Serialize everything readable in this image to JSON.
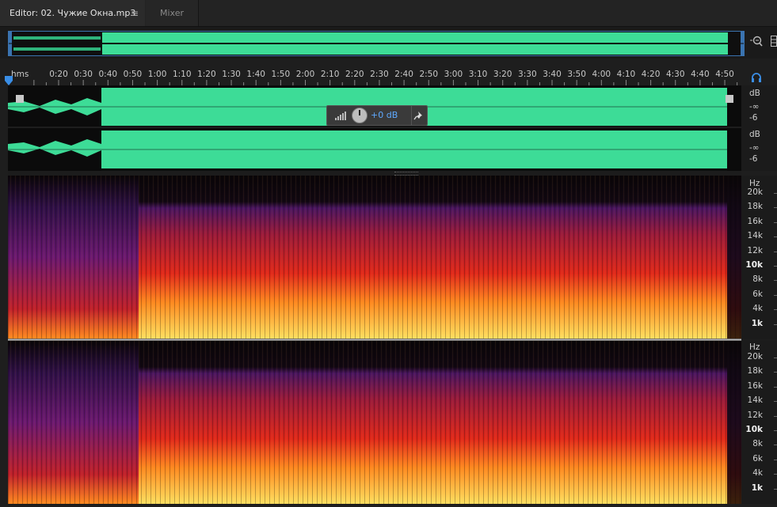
{
  "tabs": {
    "editor_label": "Editor: 02. Чужие Окна.mp3",
    "menu_glyph": "≡",
    "mixer_label": "Mixer"
  },
  "overview": {
    "zoom_icon": "zoom-selection-icon",
    "layout_icon": "panel-layout-icon"
  },
  "ruler": {
    "units": "hms",
    "labels": [
      "0:20",
      "0:30",
      "0:40",
      "0:50",
      "1:00",
      "1:10",
      "1:20",
      "1:30",
      "1:40",
      "1:50",
      "2:00",
      "2:10",
      "2:20",
      "2:30",
      "2:40",
      "2:50",
      "3:00",
      "3:10",
      "3:20",
      "3:30",
      "3:40",
      "3:50",
      "4:00",
      "4:10",
      "4:20",
      "4:30",
      "4:40",
      "4:50"
    ],
    "snap_icon": "headphones-icon"
  },
  "hud": {
    "value": "+0 dB"
  },
  "waveform_scale": {
    "upper": {
      "unit": "dB",
      "inf": "-∞",
      "minus6": "-6"
    },
    "lower": {
      "unit": "dB",
      "inf": "-∞",
      "minus6": "-6"
    }
  },
  "spectral_scale": {
    "unit": "Hz",
    "labels": [
      "20k",
      "18k",
      "16k",
      "14k",
      "12k",
      "10k",
      "8k",
      "6k",
      "4k",
      "1k"
    ]
  },
  "colors": {
    "waveform": "#3ddc97",
    "accent": "#3a8ee6",
    "spectrum_low": "#ffd24a",
    "spectrum_mid": "#e02a10",
    "spectrum_high": "#3a0e5a"
  }
}
